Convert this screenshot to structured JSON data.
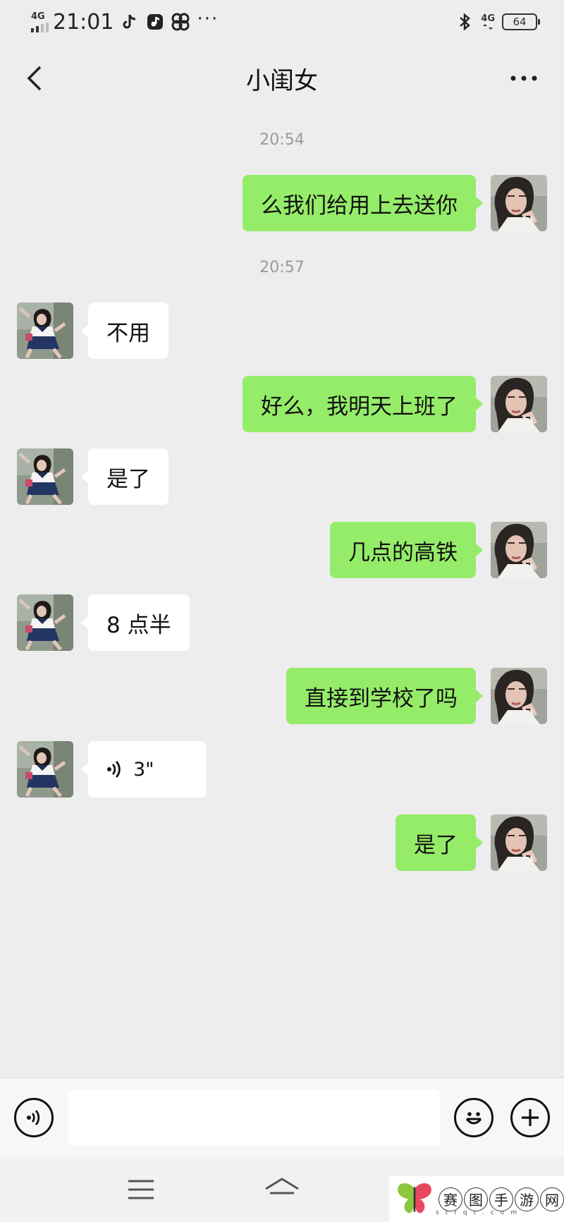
{
  "status_bar": {
    "network": "4G",
    "time": "21:01",
    "network_right": "4G",
    "battery": "64",
    "icons": [
      "tiktok-icon",
      "music-app-icon",
      "pinwheel-icon",
      "more-dots-icon",
      "bluetooth-icon"
    ]
  },
  "header": {
    "title": "小闺女",
    "back_icon": "chevron-left-icon",
    "more_icon": "ellipsis-icon"
  },
  "messages": [
    {
      "type": "time",
      "text": "20:54"
    },
    {
      "type": "text",
      "from": "me",
      "text": "么我们给用上去送你"
    },
    {
      "type": "time",
      "text": "20:57"
    },
    {
      "type": "text",
      "from": "her",
      "text": "不用"
    },
    {
      "type": "text",
      "from": "me",
      "text": "好么，我明天上班了"
    },
    {
      "type": "text",
      "from": "her",
      "text": "是了"
    },
    {
      "type": "text",
      "from": "me",
      "text": "几点的高铁"
    },
    {
      "type": "text",
      "from": "her",
      "text": "8 点半"
    },
    {
      "type": "text",
      "from": "me",
      "text": "直接到学校了吗"
    },
    {
      "type": "voice",
      "from": "her",
      "text": "3\""
    },
    {
      "type": "text",
      "from": "me",
      "text": "是了"
    }
  ],
  "input_bar": {
    "placeholder": "",
    "value": "",
    "icons": [
      "voice-input-icon",
      "emoji-icon",
      "plus-icon"
    ]
  },
  "system_nav": {
    "icons": [
      "menu-icon",
      "home-icon"
    ]
  },
  "watermark": {
    "chars": [
      "赛",
      "图",
      "手",
      "游",
      "网"
    ],
    "url": "strqt.com"
  },
  "colors": {
    "background": "#ededed",
    "sent_bubble": "#95ec69",
    "received_bubble": "#ffffff",
    "timestamp": "#9a9a9a"
  }
}
